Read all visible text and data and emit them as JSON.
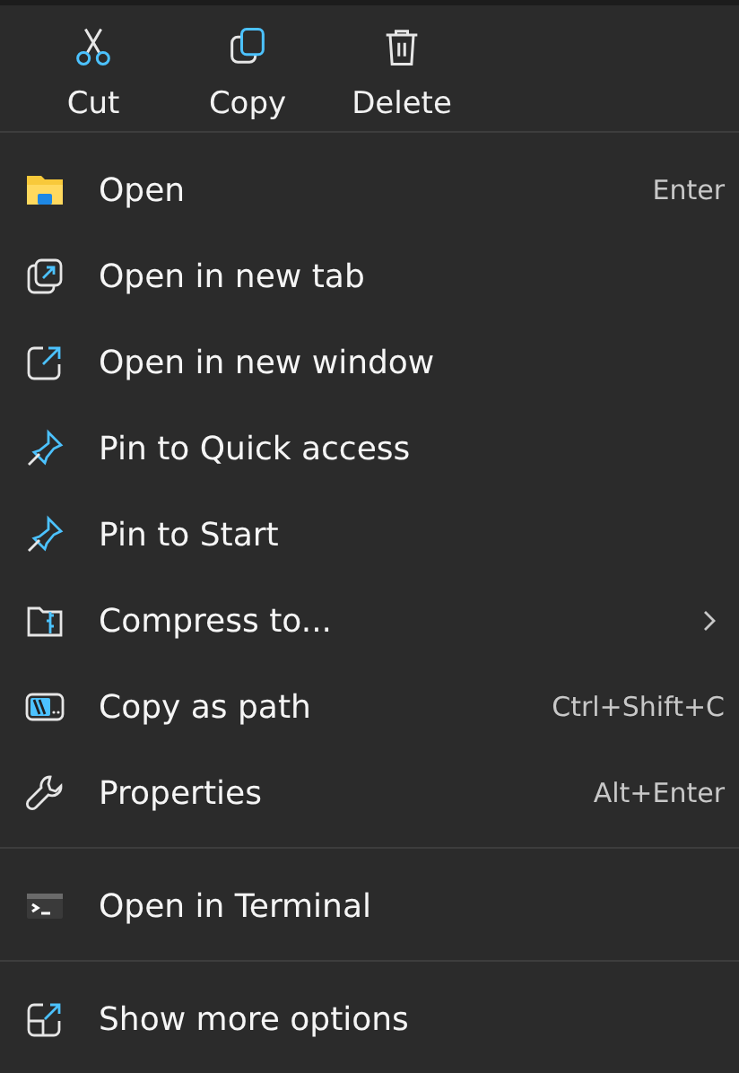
{
  "toolbar": [
    {
      "label": "Cut"
    },
    {
      "label": "Copy"
    },
    {
      "label": "Delete"
    }
  ],
  "sections": [
    {
      "items": [
        {
          "label": "Open",
          "shortcut": "Enter",
          "has_submenu": false
        },
        {
          "label": "Open in new tab",
          "has_submenu": false
        },
        {
          "label": "Open in new window",
          "has_submenu": false
        },
        {
          "label": "Pin to Quick access",
          "has_submenu": false
        },
        {
          "label": "Pin to Start",
          "has_submenu": false
        },
        {
          "label": "Compress to...",
          "has_submenu": true
        },
        {
          "label": "Copy as path",
          "shortcut": "Ctrl+Shift+C",
          "has_submenu": false
        },
        {
          "label": "Properties",
          "shortcut": "Alt+Enter",
          "has_submenu": false
        }
      ]
    },
    {
      "items": [
        {
          "label": "Open in Terminal",
          "has_submenu": false
        }
      ]
    },
    {
      "items": [
        {
          "label": "Show more options",
          "has_submenu": false
        }
      ]
    }
  ]
}
